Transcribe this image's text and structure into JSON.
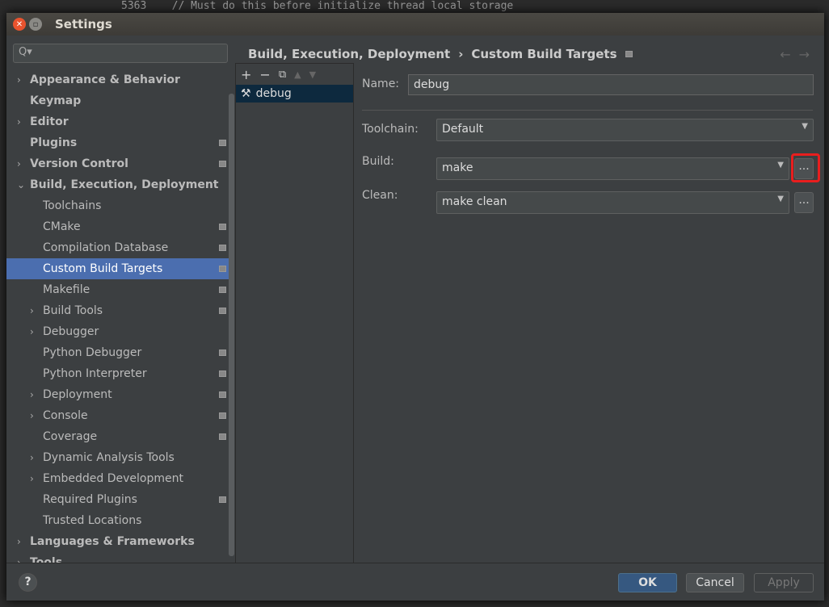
{
  "background": {
    "code_line": "5363    // Must do this before initialize thread local storage"
  },
  "window": {
    "title": "Settings"
  },
  "search": {
    "placeholder": "Q▾"
  },
  "tree": [
    {
      "label": "Appearance & Behavior",
      "level": 0,
      "arrow": true,
      "bold": true,
      "page": false
    },
    {
      "label": "Keymap",
      "level": 0,
      "arrow": false,
      "bold": true,
      "page": false
    },
    {
      "label": "Editor",
      "level": 0,
      "arrow": true,
      "bold": true,
      "page": false
    },
    {
      "label": "Plugins",
      "level": 0,
      "arrow": false,
      "bold": true,
      "page": true
    },
    {
      "label": "Version Control",
      "level": 0,
      "arrow": true,
      "bold": true,
      "page": true
    },
    {
      "label": "Build, Execution, Deployment",
      "level": 0,
      "arrow": "open",
      "bold": true,
      "page": false
    },
    {
      "label": "Toolchains",
      "level": 1,
      "arrow": false,
      "page": false
    },
    {
      "label": "CMake",
      "level": 1,
      "arrow": false,
      "page": true
    },
    {
      "label": "Compilation Database",
      "level": 1,
      "arrow": false,
      "page": true
    },
    {
      "label": "Custom Build Targets",
      "level": 1,
      "arrow": false,
      "page": true,
      "selected": true
    },
    {
      "label": "Makefile",
      "level": 1,
      "arrow": false,
      "page": true
    },
    {
      "label": "Build Tools",
      "level": 1,
      "arrow": true,
      "page": true
    },
    {
      "label": "Debugger",
      "level": 1,
      "arrow": true,
      "page": false
    },
    {
      "label": "Python Debugger",
      "level": 1,
      "arrow": false,
      "page": true
    },
    {
      "label": "Python Interpreter",
      "level": 1,
      "arrow": false,
      "page": true
    },
    {
      "label": "Deployment",
      "level": 1,
      "arrow": true,
      "page": true
    },
    {
      "label": "Console",
      "level": 1,
      "arrow": true,
      "page": true
    },
    {
      "label": "Coverage",
      "level": 1,
      "arrow": false,
      "page": true
    },
    {
      "label": "Dynamic Analysis Tools",
      "level": 1,
      "arrow": true,
      "page": false
    },
    {
      "label": "Embedded Development",
      "level": 1,
      "arrow": true,
      "page": false
    },
    {
      "label": "Required Plugins",
      "level": 1,
      "arrow": false,
      "page": true
    },
    {
      "label": "Trusted Locations",
      "level": 1,
      "arrow": false,
      "page": false
    },
    {
      "label": "Languages & Frameworks",
      "level": 0,
      "arrow": true,
      "bold": true,
      "page": false
    },
    {
      "label": "Tools",
      "level": 0,
      "arrow": true,
      "bold": true,
      "page": false
    }
  ],
  "breadcrumb": {
    "parent": "Build, Execution, Deployment",
    "separator": "›",
    "current": "Custom Build Targets"
  },
  "targets": {
    "items": [
      "debug"
    ]
  },
  "form": {
    "name_label": "Name:",
    "name_value": "debug",
    "toolchain_label": "Toolchain:",
    "toolchain_value": "Default",
    "build_label": "Build:",
    "build_value": "make",
    "clean_label": "Clean:",
    "clean_value": "make clean",
    "browse_label": "..."
  },
  "buttons": {
    "help": "?",
    "ok": "OK",
    "cancel": "Cancel",
    "apply": "Apply"
  },
  "colors": {
    "selection": "#4b6eaf",
    "highlight": "#e81e1e",
    "ok": "#365880"
  }
}
